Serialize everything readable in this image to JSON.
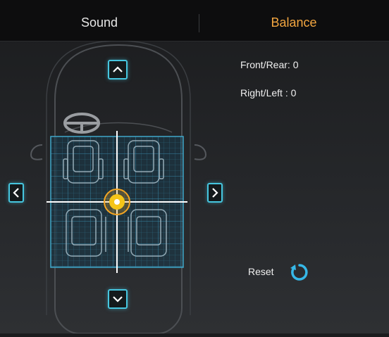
{
  "tabs": {
    "sound_label": "Sound",
    "balance_label": "Balance",
    "active": "Balance"
  },
  "balance": {
    "front_rear_label": "Front/Rear: 0",
    "right_left_label": "Right/Left : 0",
    "front_rear_value": 0,
    "right_left_value": 0
  },
  "controls": {
    "reset_label": "Reset",
    "up_icon": "chevron-up-icon",
    "down_icon": "chevron-down-icon",
    "left_icon": "chevron-left-icon",
    "right_icon": "chevron-right-icon",
    "reset_icon": "refresh-icon"
  },
  "colors": {
    "accent_orange": "#f3a640",
    "grid_blue": "#3fa7c9",
    "button_border": "#46c6df",
    "marker_yellow": "#f5c518"
  }
}
